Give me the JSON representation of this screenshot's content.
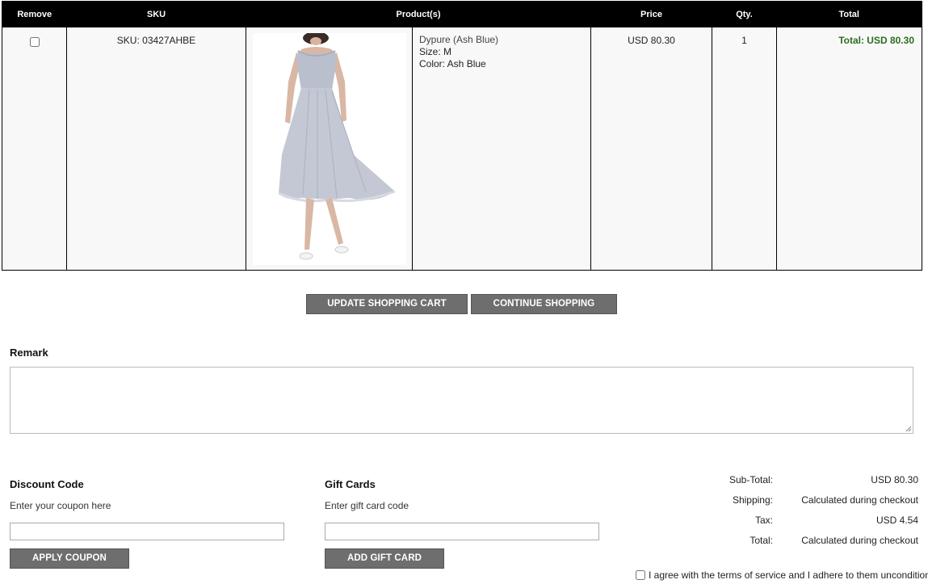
{
  "cart": {
    "headers": {
      "remove": "Remove",
      "sku": "SKU",
      "products": "Product(s)",
      "price": "Price",
      "qty": "Qty.",
      "total": "Total"
    },
    "items": [
      {
        "sku": "SKU: 03427AHBE",
        "name": "Dypure (Ash Blue)",
        "size": "Size: M",
        "color": "Color: Ash Blue",
        "price": "USD 80.30",
        "qty": "1",
        "total": "Total: USD 80.30",
        "image_icon": "dress-product-image",
        "remove_checked": false
      }
    ],
    "total_color": "#2b6e1f"
  },
  "actions": {
    "update_label": "UPDATE SHOPPING CART",
    "continue_label": "CONTINUE SHOPPING"
  },
  "remark": {
    "label": "Remark",
    "value": ""
  },
  "discount": {
    "title": "Discount Code",
    "hint": "Enter your coupon here",
    "value": "",
    "button_label": "APPLY COUPON"
  },
  "gift": {
    "title": "Gift Cards",
    "hint": "Enter gift card code",
    "value": "",
    "button_label": "ADD GIFT CARD"
  },
  "totals": [
    {
      "label": "Sub-Total:",
      "value": "USD 80.30"
    },
    {
      "label": "Shipping:",
      "value": "Calculated during checkout"
    },
    {
      "label": "Tax:",
      "value": "USD 4.54"
    },
    {
      "label": "Total:",
      "value": "Calculated during checkout"
    }
  ],
  "terms": {
    "label": "I agree with the terms of service and I adhere to them unconditionally",
    "checked": false
  },
  "colors": {
    "header_bg": "#000000",
    "button_bg": "#6e6e6e",
    "row_bg": "#f8f8f8"
  }
}
